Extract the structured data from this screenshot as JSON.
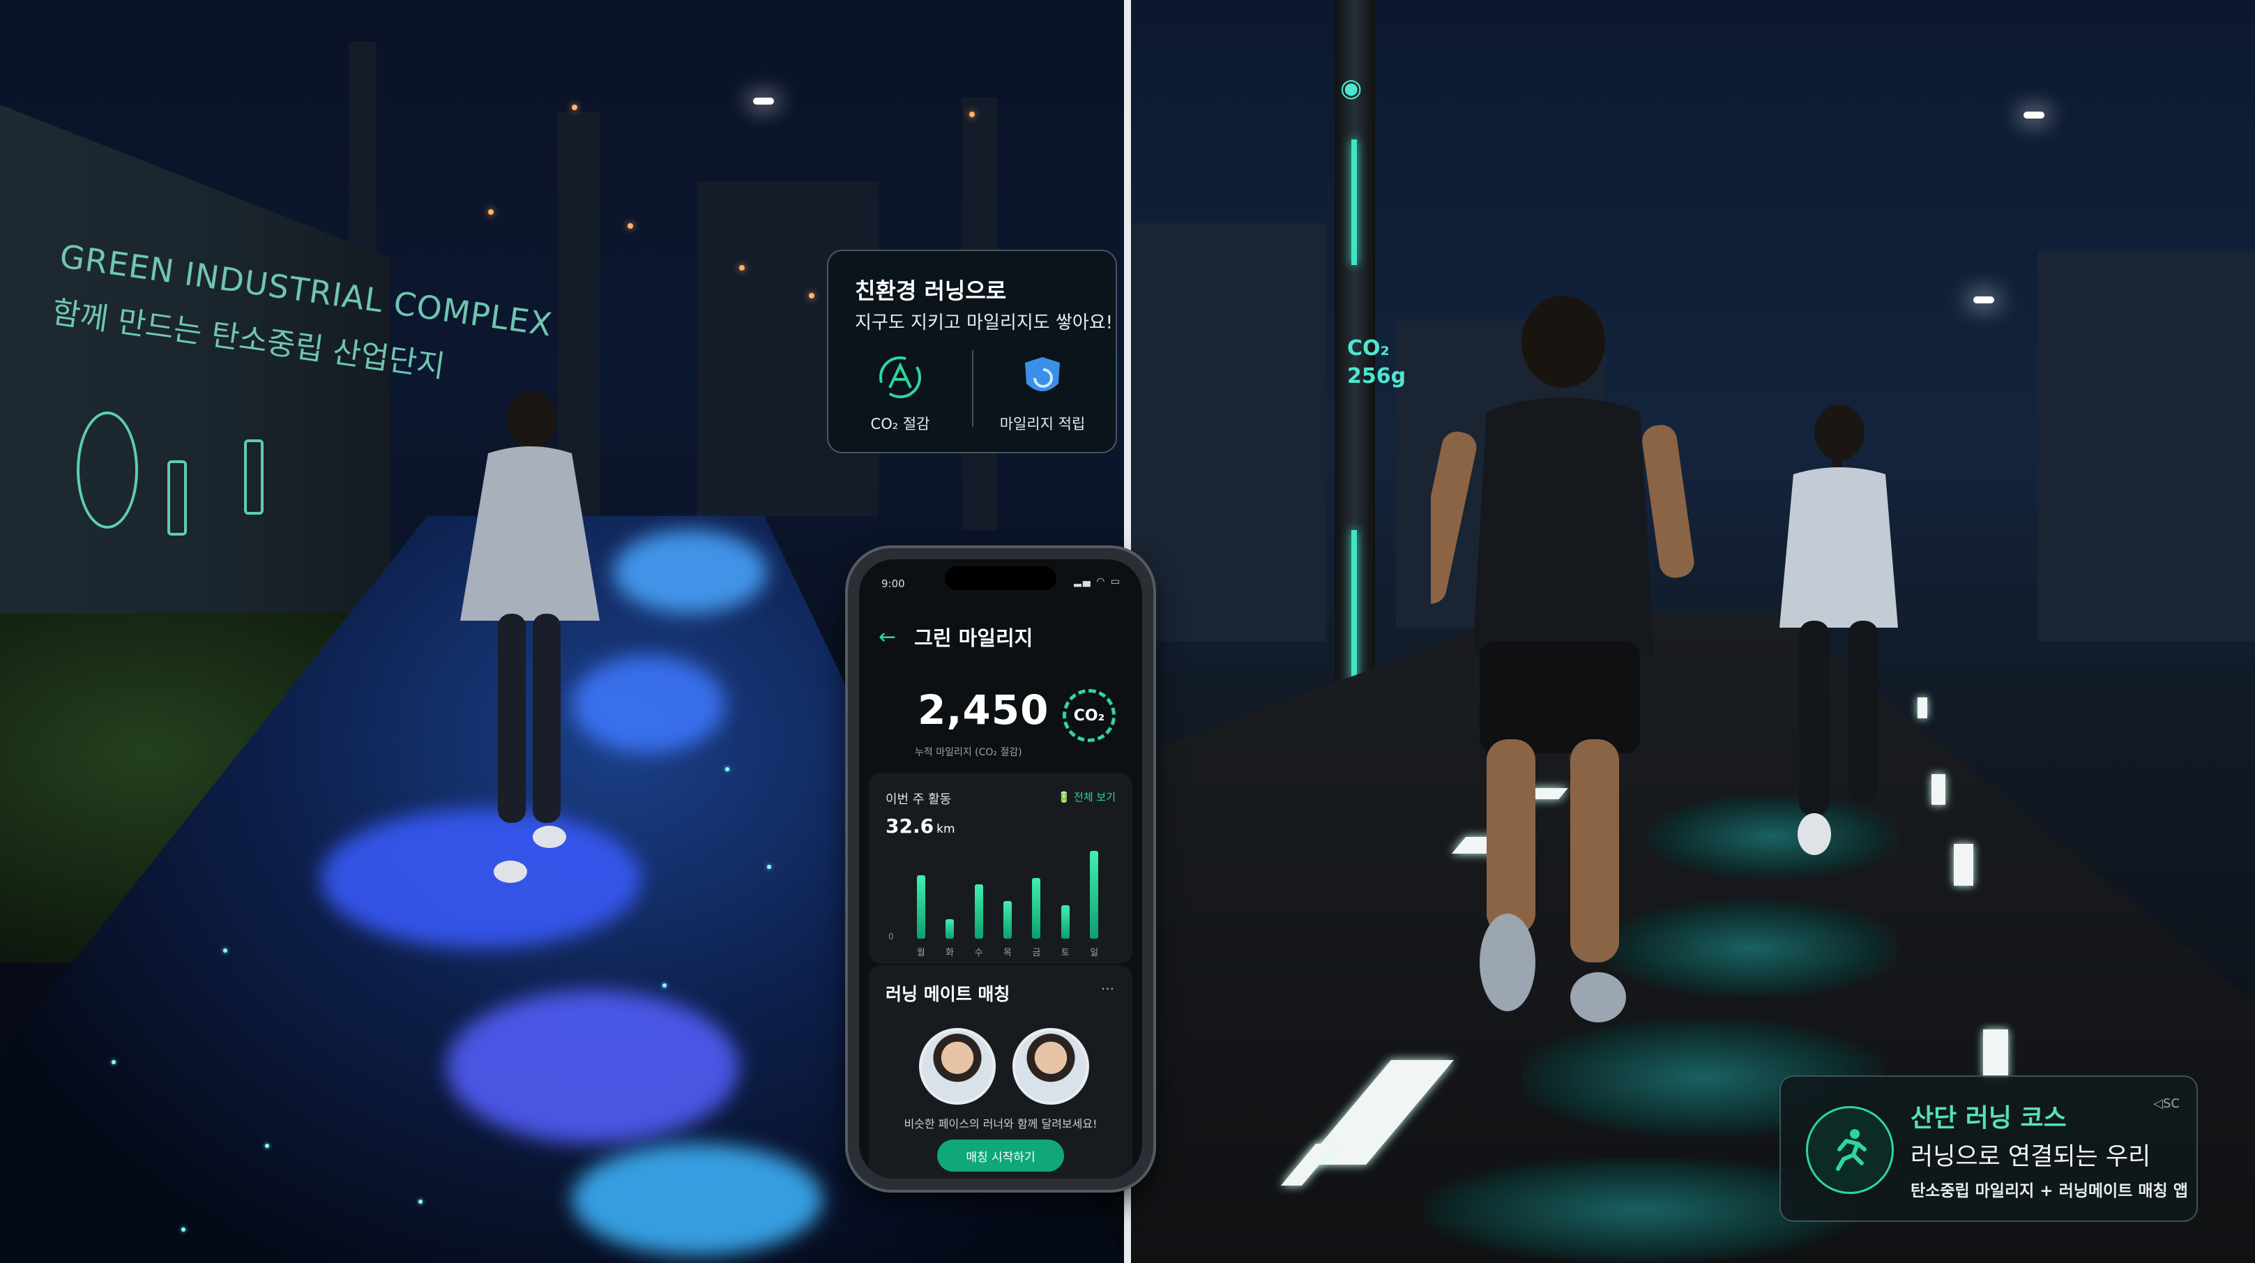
{
  "left_scene": {
    "wall_line1": "GREEN INDUSTRIAL COMPLEX",
    "wall_line2": "함께 만드는 탄소중립 산업단지"
  },
  "callout": {
    "title": "친환경 러닝으로",
    "subtitle": "지구도 지키고 마일리지도 쌓아요!",
    "features": [
      {
        "icon": "co2-reduction-icon",
        "label": "CO₂ 절감"
      },
      {
        "icon": "mileage-shield-icon",
        "label": "마일리지 적립"
      }
    ]
  },
  "phone": {
    "status_time": "9:00",
    "status_icons": "▂▄ ◠ ▭",
    "header_title": "그린 마일리지",
    "mileage_value": "2,450",
    "co2_badge": "CO₂",
    "mileage_caption": "누적 마일리지 (CO₂ 절감)",
    "weekly": {
      "title": "이번 주 활동",
      "link": "🔋 전체 보기",
      "distance_value": "32.6",
      "distance_unit": "km",
      "y_zero": "0"
    },
    "mate": {
      "title": "러닝 메이트 매칭",
      "more": "···",
      "description": "비슷한 페이스의 러너와 함께 달려보세요!",
      "button": "매칭 시작하기"
    }
  },
  "chart_data": {
    "type": "bar",
    "categories": [
      "월",
      "화",
      "수",
      "목",
      "금",
      "토",
      "일"
    ],
    "values": [
      4.2,
      1.3,
      3.6,
      2.5,
      4.0,
      2.2,
      5.8
    ],
    "ylim": [
      0,
      6
    ]
  },
  "right_scene": {
    "pole_co2": "CO₂",
    "pole_value": "256g",
    "badge_title": "산단 러닝 코스",
    "badge_subtitle": "러닝으로 연결되는 우리",
    "badge_desc": "탄소중립 마일리지 + 러닝메이트 매칭 앱",
    "badge_logo": "◁SC"
  },
  "colors": {
    "accent": "#2fd59e",
    "path_glow": "#1b3f88",
    "pole_glow": "#3fe6c6"
  }
}
